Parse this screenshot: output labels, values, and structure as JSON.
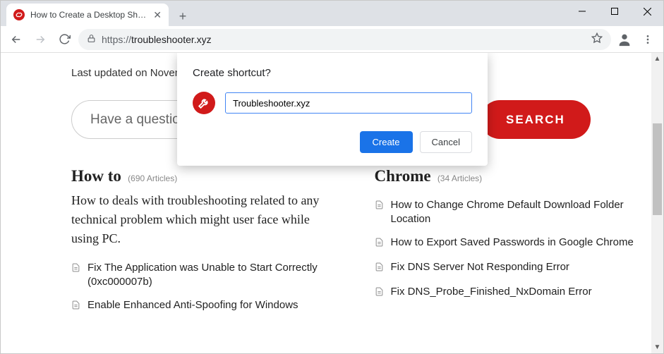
{
  "browser": {
    "tab_title": "How to Create a Desktop Shortcu",
    "url_scheme": "https://",
    "url_host": "troubleshooter.xyz"
  },
  "dialog": {
    "title": "Create shortcut?",
    "input_value": "Troubleshooter.xyz",
    "create_label": "Create",
    "cancel_label": "Cancel"
  },
  "page": {
    "last_updated": "Last updated on November",
    "search_placeholder": "Have a question",
    "search_button": "SEARCH",
    "howto": {
      "heading": "How to",
      "count": "(690 Articles)",
      "desc": "How to deals with troubleshooting related to any technical problem which might user face while using PC.",
      "articles": [
        "Fix The Application was Unable to Start Correctly (0xc000007b)",
        "Enable Enhanced Anti-Spoofing for Windows"
      ]
    },
    "chrome": {
      "heading": "Chrome",
      "count": "(34 Articles)",
      "articles": [
        "How to Change Chrome Default Download Folder Location",
        "How to Export Saved Passwords in Google Chrome",
        "Fix DNS Server Not Responding Error",
        "Fix DNS_Probe_Finished_NxDomain Error"
      ]
    }
  }
}
